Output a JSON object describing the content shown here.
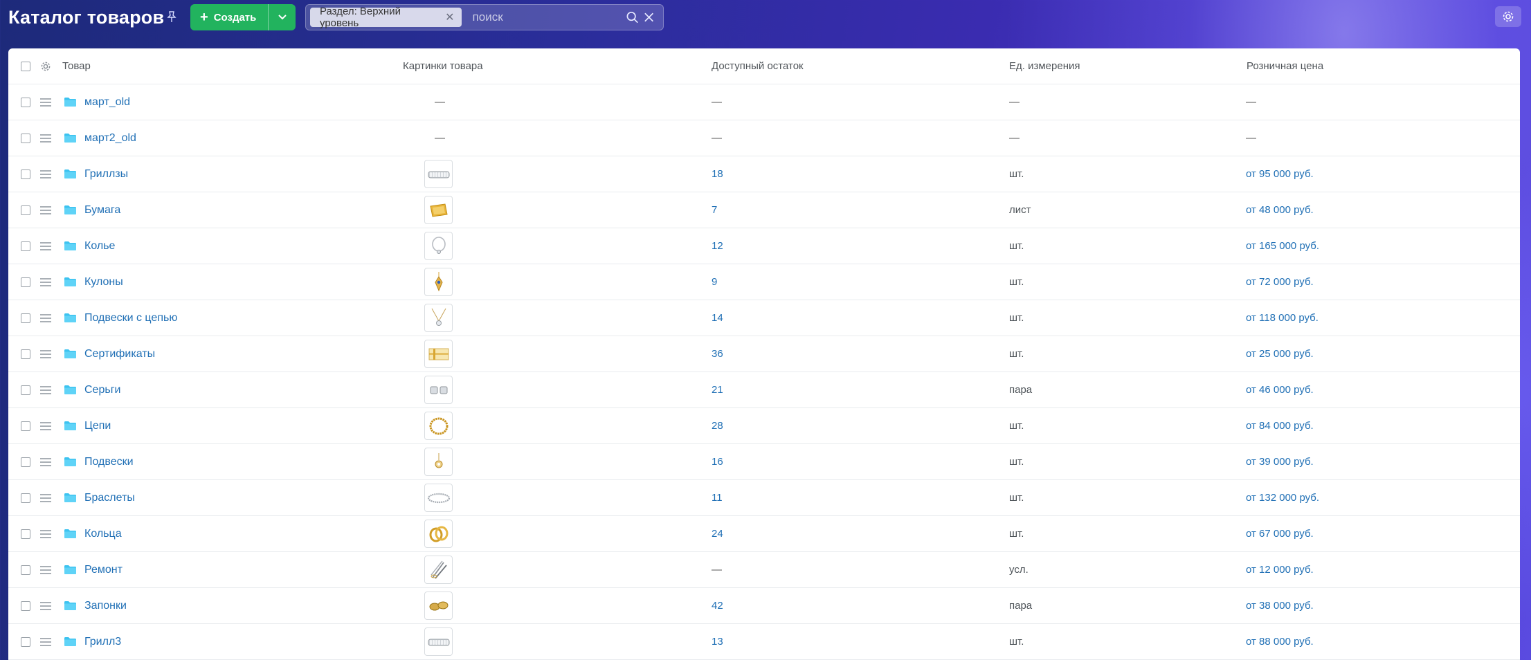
{
  "header": {
    "title": "Каталог товаров",
    "create_label": "Создать",
    "filter_chip": "Раздел: Верхний уровень",
    "search_placeholder": "поиск"
  },
  "table": {
    "columns": [
      "Товар",
      "Картинки товара",
      "Доступный остаток",
      "Ед. измерения",
      "Розничная цена"
    ],
    "rows": [
      {
        "name": "март_old",
        "image": "",
        "stock": "—",
        "unit": "—",
        "price": "—"
      },
      {
        "name": "март2_old",
        "image": "",
        "stock": "—",
        "unit": "—",
        "price": "—"
      },
      {
        "name": "Гриллзы",
        "image": "grillz",
        "stock": "18",
        "unit": "шт.",
        "price": "от 95 000 руб."
      },
      {
        "name": "Бумага",
        "image": "paper",
        "stock": "7",
        "unit": "лист",
        "price": "от 48 000 руб."
      },
      {
        "name": "Колье",
        "image": "necklace",
        "stock": "12",
        "unit": "шт.",
        "price": "от 165 000 руб."
      },
      {
        "name": "Кулоны",
        "image": "pendant",
        "stock": "9",
        "unit": "шт.",
        "price": "от 72 000 руб."
      },
      {
        "name": "Подвески с цепью",
        "image": "chain-pendant",
        "stock": "14",
        "unit": "шт.",
        "price": "от 118 000 руб."
      },
      {
        "name": "Сертификаты",
        "image": "certificate",
        "stock": "36",
        "unit": "шт.",
        "price": "от 25 000 руб."
      },
      {
        "name": "Серьги",
        "image": "earrings",
        "stock": "21",
        "unit": "пара",
        "price": "от 46 000 руб."
      },
      {
        "name": "Цепи",
        "image": "chain",
        "stock": "28",
        "unit": "шт.",
        "price": "от 84 000 руб."
      },
      {
        "name": "Подвески",
        "image": "small-pendant",
        "stock": "16",
        "unit": "шт.",
        "price": "от 39 000 руб."
      },
      {
        "name": "Браслеты",
        "image": "bracelet",
        "stock": "11",
        "unit": "шт.",
        "price": "от 132 000 руб."
      },
      {
        "name": "Кольца",
        "image": "rings",
        "stock": "24",
        "unit": "шт.",
        "price": "от 67 000 руб."
      },
      {
        "name": "Ремонт",
        "image": "tools",
        "stock": "—",
        "unit": "усл.",
        "price": "от 12 000 руб."
      },
      {
        "name": "Запонки",
        "image": "cufflinks",
        "stock": "42",
        "unit": "пара",
        "price": "от 38 000 руб."
      },
      {
        "name": "Грилл3",
        "image": "grillz",
        "stock": "13",
        "unit": "шт.",
        "price": "от 88 000 руб."
      }
    ]
  },
  "colors": {
    "accent_green": "#22b35e",
    "link": "#1f6fb5",
    "folder": "#3cc3f0"
  }
}
